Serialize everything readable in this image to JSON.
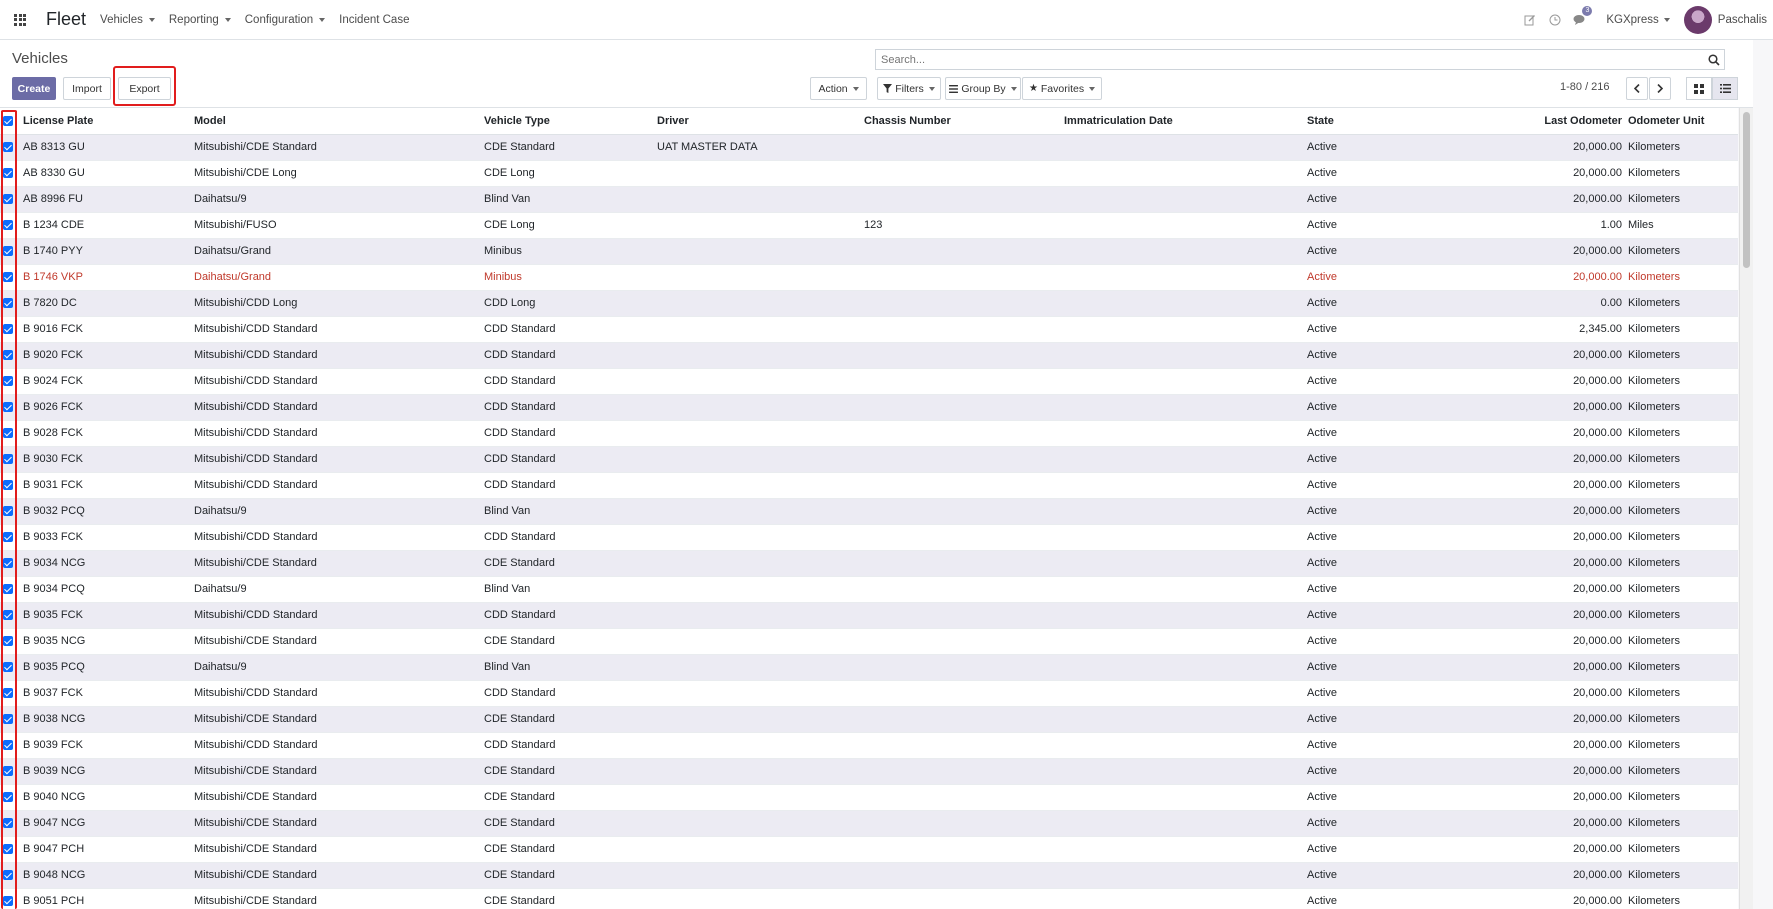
{
  "navbar": {
    "brand": "Fleet",
    "menus": [
      "Vehicles",
      "Reporting",
      "Configuration"
    ],
    "incident_case": "Incident Case",
    "message_count": "3",
    "company": "KGXpress",
    "user": "Paschalis"
  },
  "control": {
    "title": "Vehicles",
    "search_placeholder": "Search...",
    "create": "Create",
    "import": "Import",
    "export": "Export",
    "action": "Action",
    "filters": "Filters",
    "group_by": "Group By",
    "favorites": "Favorites",
    "pager": "1-80 / 216"
  },
  "table": {
    "columns": [
      "License Plate",
      "Model",
      "Vehicle Type",
      "Driver",
      "Chassis Number",
      "Immatriculation Date",
      "State",
      "Last Odometer",
      "Odometer Unit"
    ],
    "rows": [
      [
        "AB 8313 GU",
        "Mitsubishi/CDE Standard",
        "CDE Standard",
        "UAT MASTER DATA",
        "",
        "",
        "Active",
        "20,000.00",
        "Kilometers"
      ],
      [
        "AB 8330 GU",
        "Mitsubishi/CDE Long",
        "CDE Long",
        "",
        "",
        "",
        "Active",
        "20,000.00",
        "Kilometers"
      ],
      [
        "AB 8996 FU",
        "Daihatsu/9",
        "Blind Van",
        "",
        "",
        "",
        "Active",
        "20,000.00",
        "Kilometers"
      ],
      [
        "B 1234 CDE",
        "Mitsubishi/FUSO",
        "CDE Long",
        "",
        "123",
        "",
        "Active",
        "1.00",
        "Miles"
      ],
      [
        "B 1740 PYY",
        "Daihatsu/Grand",
        "Minibus",
        "",
        "",
        "",
        "Active",
        "20,000.00",
        "Kilometers"
      ],
      [
        "B 1746 VKP",
        "Daihatsu/Grand",
        "Minibus",
        "",
        "",
        "",
        "Active",
        "20,000.00",
        "Kilometers"
      ],
      [
        "B 7820 DC",
        "Mitsubishi/CDD Long",
        "CDD Long",
        "",
        "",
        "",
        "Active",
        "0.00",
        "Kilometers"
      ],
      [
        "B 9016 FCK",
        "Mitsubishi/CDD Standard",
        "CDD Standard",
        "",
        "",
        "",
        "Active",
        "2,345.00",
        "Kilometers"
      ],
      [
        "B 9020 FCK",
        "Mitsubishi/CDD Standard",
        "CDD Standard",
        "",
        "",
        "",
        "Active",
        "20,000.00",
        "Kilometers"
      ],
      [
        "B 9024 FCK",
        "Mitsubishi/CDD Standard",
        "CDD Standard",
        "",
        "",
        "",
        "Active",
        "20,000.00",
        "Kilometers"
      ],
      [
        "B 9026 FCK",
        "Mitsubishi/CDD Standard",
        "CDD Standard",
        "",
        "",
        "",
        "Active",
        "20,000.00",
        "Kilometers"
      ],
      [
        "B 9028 FCK",
        "Mitsubishi/CDD Standard",
        "CDD Standard",
        "",
        "",
        "",
        "Active",
        "20,000.00",
        "Kilometers"
      ],
      [
        "B 9030 FCK",
        "Mitsubishi/CDD Standard",
        "CDD Standard",
        "",
        "",
        "",
        "Active",
        "20,000.00",
        "Kilometers"
      ],
      [
        "B 9031 FCK",
        "Mitsubishi/CDD Standard",
        "CDD Standard",
        "",
        "",
        "",
        "Active",
        "20,000.00",
        "Kilometers"
      ],
      [
        "B 9032 PCQ",
        "Daihatsu/9",
        "Blind Van",
        "",
        "",
        "",
        "Active",
        "20,000.00",
        "Kilometers"
      ],
      [
        "B 9033 FCK",
        "Mitsubishi/CDD Standard",
        "CDD Standard",
        "",
        "",
        "",
        "Active",
        "20,000.00",
        "Kilometers"
      ],
      [
        "B 9034 NCG",
        "Mitsubishi/CDE Standard",
        "CDE Standard",
        "",
        "",
        "",
        "Active",
        "20,000.00",
        "Kilometers"
      ],
      [
        "B 9034 PCQ",
        "Daihatsu/9",
        "Blind Van",
        "",
        "",
        "",
        "Active",
        "20,000.00",
        "Kilometers"
      ],
      [
        "B 9035 FCK",
        "Mitsubishi/CDD Standard",
        "CDD Standard",
        "",
        "",
        "",
        "Active",
        "20,000.00",
        "Kilometers"
      ],
      [
        "B 9035 NCG",
        "Mitsubishi/CDE Standard",
        "CDE Standard",
        "",
        "",
        "",
        "Active",
        "20,000.00",
        "Kilometers"
      ],
      [
        "B 9035 PCQ",
        "Daihatsu/9",
        "Blind Van",
        "",
        "",
        "",
        "Active",
        "20,000.00",
        "Kilometers"
      ],
      [
        "B 9037 FCK",
        "Mitsubishi/CDD Standard",
        "CDD Standard",
        "",
        "",
        "",
        "Active",
        "20,000.00",
        "Kilometers"
      ],
      [
        "B 9038 NCG",
        "Mitsubishi/CDE Standard",
        "CDE Standard",
        "",
        "",
        "",
        "Active",
        "20,000.00",
        "Kilometers"
      ],
      [
        "B 9039 FCK",
        "Mitsubishi/CDD Standard",
        "CDD Standard",
        "",
        "",
        "",
        "Active",
        "20,000.00",
        "Kilometers"
      ],
      [
        "B 9039 NCG",
        "Mitsubishi/CDE Standard",
        "CDE Standard",
        "",
        "",
        "",
        "Active",
        "20,000.00",
        "Kilometers"
      ],
      [
        "B 9040 NCG",
        "Mitsubishi/CDE Standard",
        "CDE Standard",
        "",
        "",
        "",
        "Active",
        "20,000.00",
        "Kilometers"
      ],
      [
        "B 9047 NCG",
        "Mitsubishi/CDE Standard",
        "CDE Standard",
        "",
        "",
        "",
        "Active",
        "20,000.00",
        "Kilometers"
      ],
      [
        "B 9047 PCH",
        "Mitsubishi/CDE Standard",
        "CDE Standard",
        "",
        "",
        "",
        "Active",
        "20,000.00",
        "Kilometers"
      ],
      [
        "B 9048 NCG",
        "Mitsubishi/CDE Standard",
        "CDE Standard",
        "",
        "",
        "",
        "Active",
        "20,000.00",
        "Kilometers"
      ],
      [
        "B 9051 PCH",
        "Mitsubishi/CDE Standard",
        "CDE Standard",
        "",
        "",
        "",
        "Active",
        "20,000.00",
        "Kilometers"
      ]
    ],
    "danger_row_index": 5
  },
  "colors": {
    "primary": "#6c6ca6",
    "highlight": "#e11d1d",
    "checkbox": "#0b6cff",
    "danger_text": "#c0392b",
    "odd_row": "#ecebf3"
  }
}
